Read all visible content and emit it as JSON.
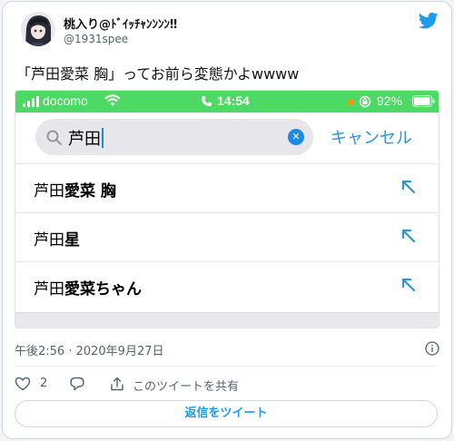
{
  "tweet": {
    "display_name": "桃入り@ﾄﾞｲｯﾁｬﾝﾝﾝﾝ‼",
    "handle": "@1931spee",
    "text": "「芦田愛菜 胸」ってお前ら変態かよwwww",
    "timestamp": "午後2:56 · 2020年9月27日",
    "like_count": "2",
    "share_label": "このツイートを共有",
    "reply_button_label": "返信をツイート"
  },
  "phone": {
    "status_bar": {
      "carrier": "docomo",
      "time": "14:54",
      "battery": "92%",
      "color": "#4cd964"
    },
    "search": {
      "value": "芦田",
      "cancel_label": "キャンセル"
    },
    "suggestions": [
      {
        "prefix": "芦田",
        "rest": "愛菜 胸"
      },
      {
        "prefix": "芦田",
        "rest": "星"
      },
      {
        "prefix": "芦田",
        "rest": "愛菜ちゃん"
      }
    ]
  },
  "colors": {
    "twitter_blue": "#1d9bf0",
    "ios_blue": "#2e93dd",
    "status_green": "#4cd964"
  }
}
